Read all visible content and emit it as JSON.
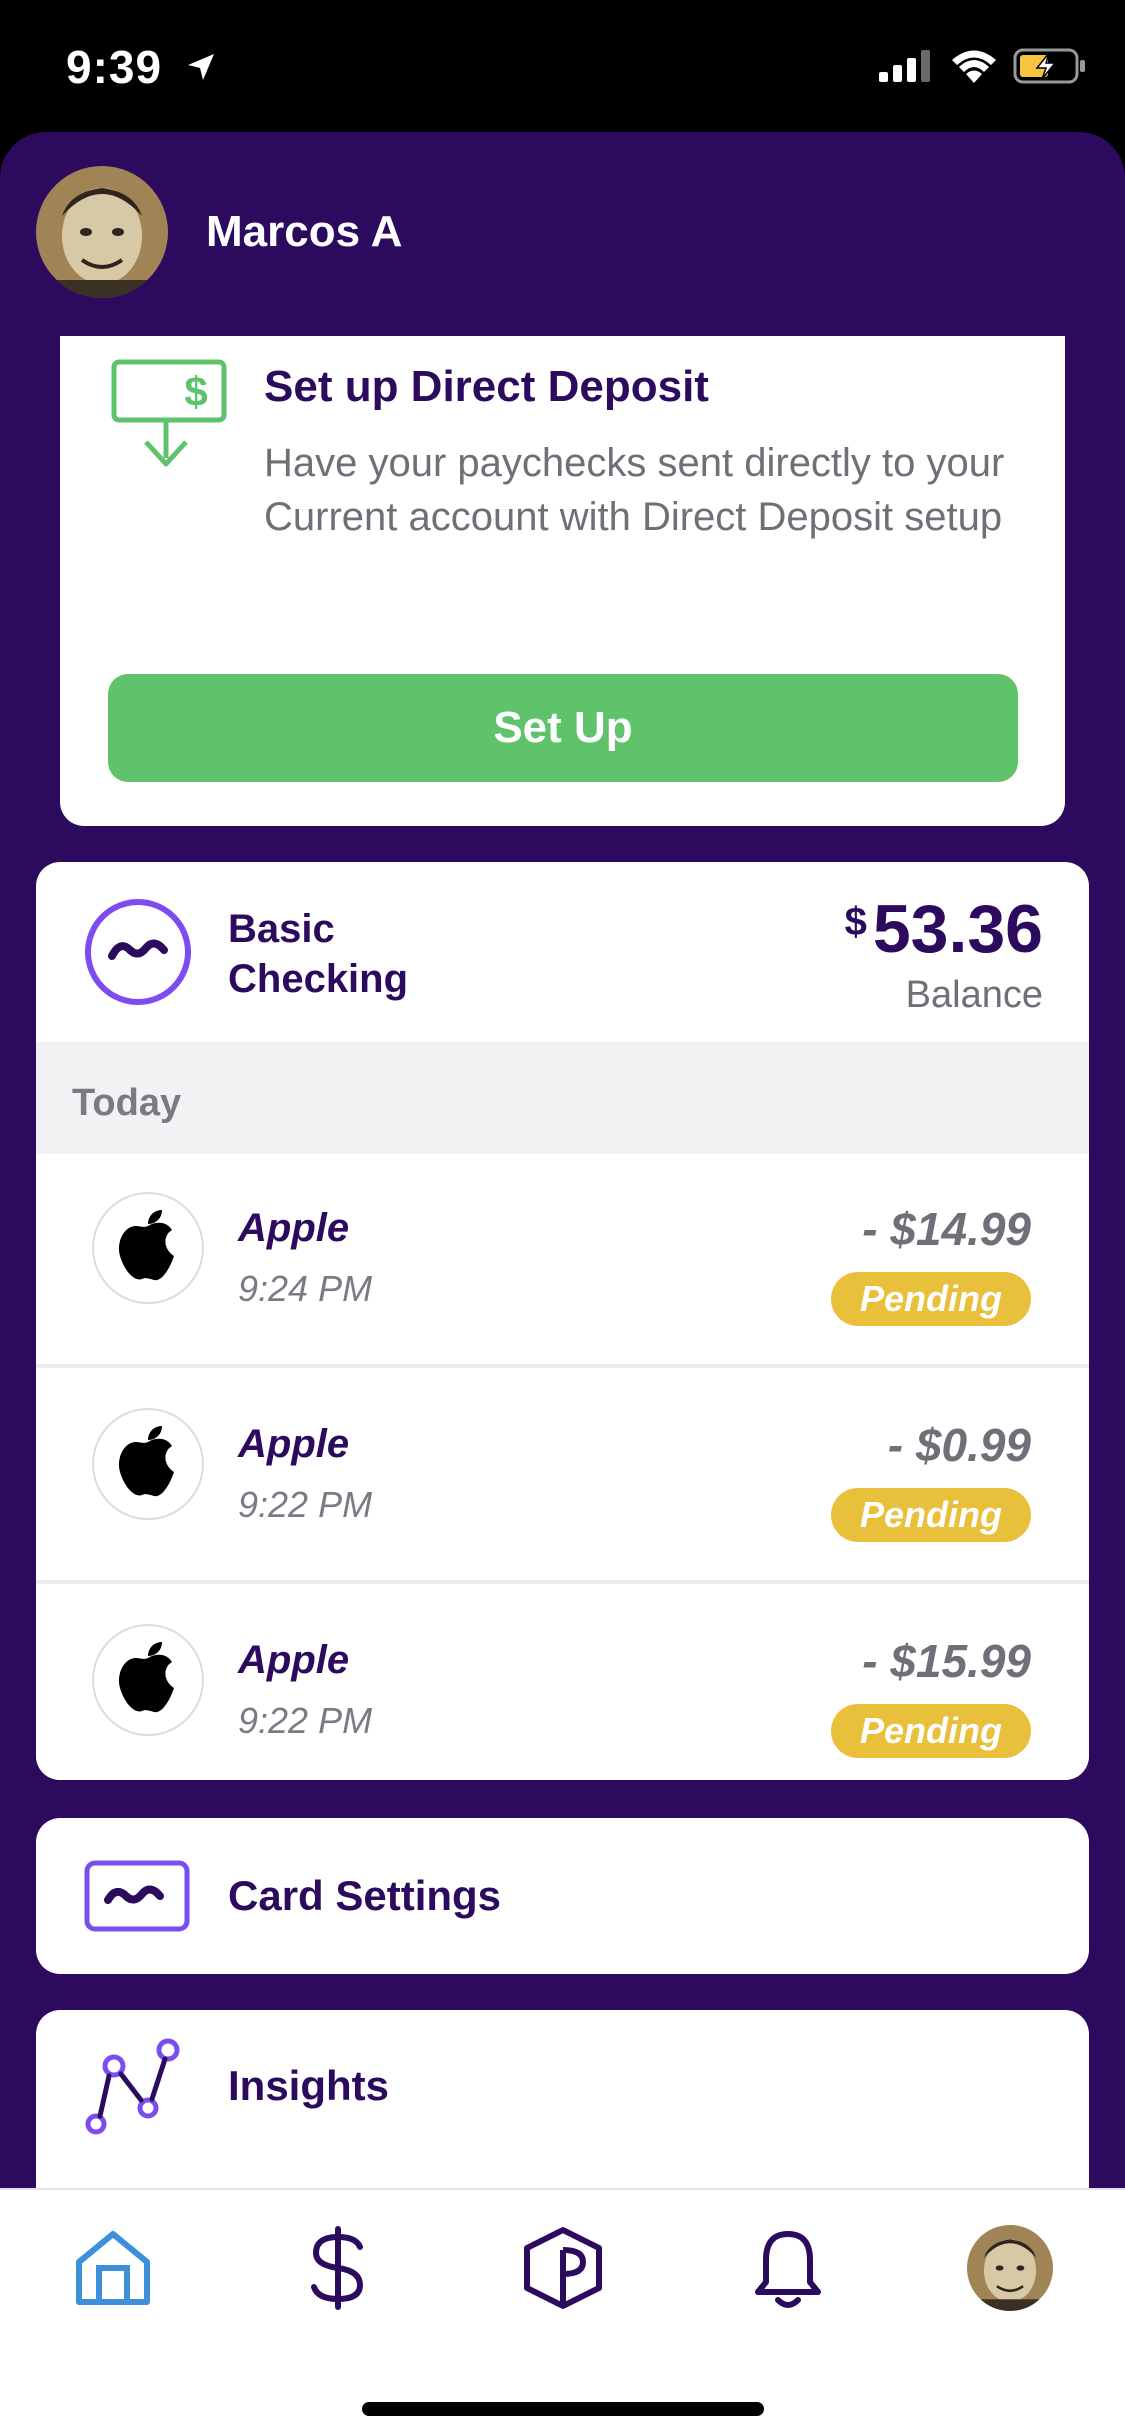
{
  "status_bar": {
    "time": "9:39"
  },
  "profile": {
    "name": "Marcos A"
  },
  "direct_deposit": {
    "title": "Set up Direct Deposit",
    "description": "Have your paychecks sent directly to your Current account with Direct Deposit setup",
    "button_label": "Set Up"
  },
  "account": {
    "name_line1": "Basic",
    "name_line2": "Checking",
    "currency_symbol": "$",
    "balance": "53.36",
    "balance_label": "Balance",
    "section_label": "Today",
    "transactions": [
      {
        "merchant": "Apple",
        "time": "9:24 PM",
        "amount": "- $14.99",
        "status": "Pending"
      },
      {
        "merchant": "Apple",
        "time": "9:22 PM",
        "amount": "- $0.99",
        "status": "Pending"
      },
      {
        "merchant": "Apple",
        "time": "9:22 PM",
        "amount": "- $15.99",
        "status": "Pending"
      }
    ]
  },
  "card_settings": {
    "label": "Card Settings"
  },
  "insights": {
    "label": "Insights"
  },
  "tab_bar": {
    "items": [
      {
        "name": "home",
        "icon": "home-icon"
      },
      {
        "name": "money",
        "icon": "dollar-icon"
      },
      {
        "name": "points",
        "icon": "cube-icon"
      },
      {
        "name": "notifications",
        "icon": "bell-icon"
      },
      {
        "name": "profile",
        "icon": "avatar"
      }
    ]
  },
  "colors": {
    "brand_purple": "#2c0a5e",
    "accent_purple": "#7b4df0",
    "success_green": "#5fc36c",
    "pending_yellow": "#e9c03b",
    "home_active_blue": "#3d8fdc"
  }
}
